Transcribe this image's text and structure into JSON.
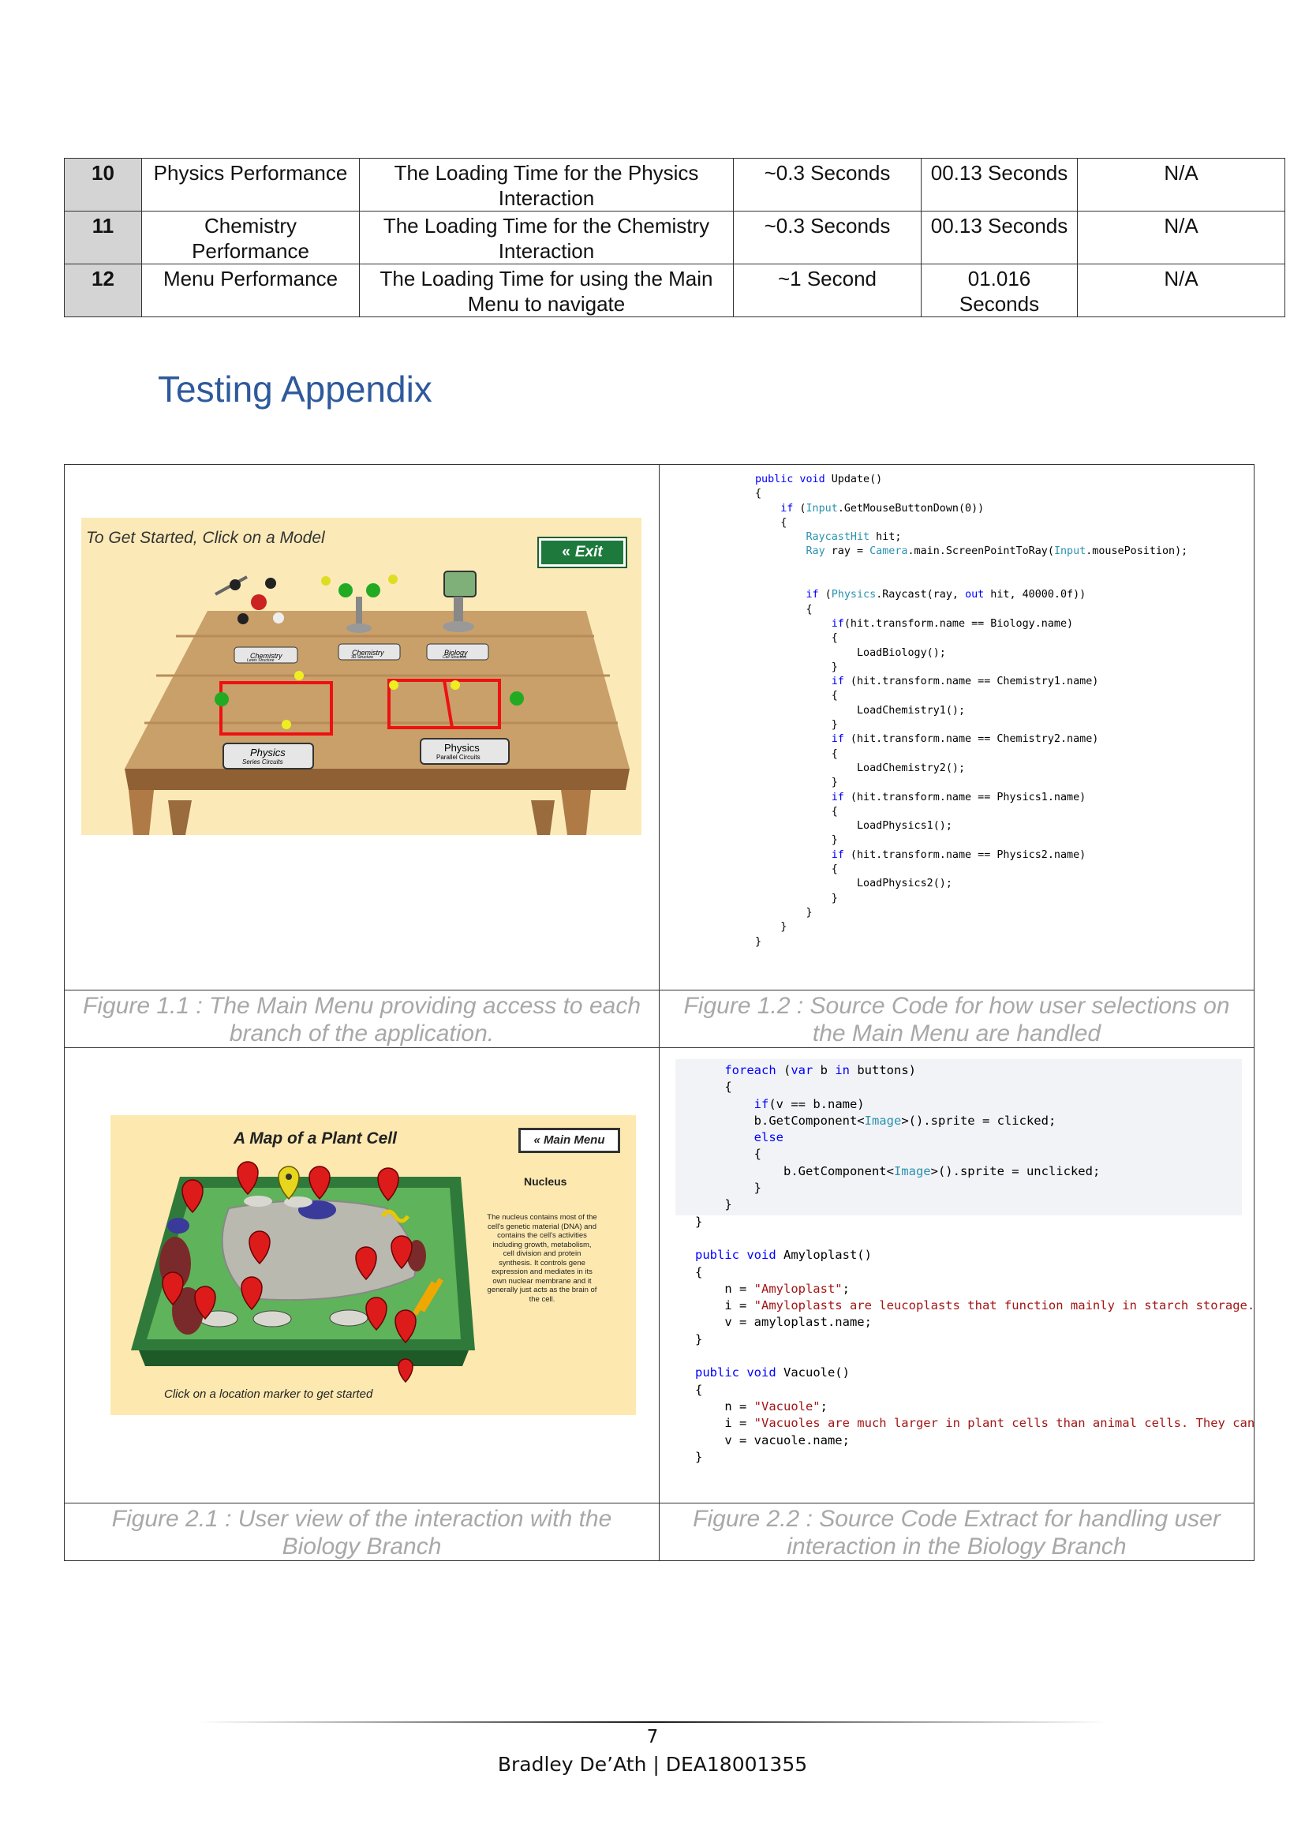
{
  "results_table": {
    "rows": [
      {
        "num": "10",
        "test": "Physics Performance",
        "description": "The Loading Time for the Physics Interaction",
        "expected": "~0.3 Seconds",
        "actual": "00.13 Seconds",
        "notes": "N/A"
      },
      {
        "num": "11",
        "test": "Chemistry Performance",
        "description": "The Loading Time for the Chemistry Interaction",
        "expected": "~0.3 Seconds",
        "actual": "00.13 Seconds",
        "notes": "N/A"
      },
      {
        "num": "12",
        "test": "Menu Performance",
        "description": "The Loading Time for using the Main Menu to navigate",
        "expected": "~1 Second",
        "actual": "01.016 Seconds",
        "notes": "N/A"
      }
    ]
  },
  "heading": "Testing Appendix",
  "figures": {
    "fig1_1": {
      "caption": "Figure 1.1 : The Main Menu providing access to each branch of the application.",
      "prompt": "To Get Started, Click on a Model",
      "exit_label": "Exit",
      "labels": [
        "Chemistry",
        "Chemistry",
        "Biology",
        "Physics",
        "Physics"
      ],
      "sublabels": [
        "Lewis Structure",
        "3D Structure",
        "Cell Structure",
        "Series Circuits",
        "Parallel Circuits"
      ]
    },
    "fig1_2": {
      "caption": "Figure 1.2 : Source Code for how user selections on the Main Menu are handled"
    },
    "fig2_1": {
      "caption": "Figure 2.1 : User view of the interaction with the Biology Branch",
      "title": "A Map of a Plant Cell",
      "menu_button": "Main Menu",
      "panel_title": "Nucleus",
      "panel_text": "The nucleus contains most of the cell's genetic material (DNA) and contains the cell's activities including growth, metabolism, cell division and protein synthesis. It controls gene expression and mediates in its own nuclear membrane and it generally just acts as the brain of the cell.",
      "hint": "Click on a location marker to get started"
    },
    "fig2_2": {
      "caption": "Figure 2.2 : Source Code Extract for handling user interaction in the Biology Branch"
    }
  },
  "footer": {
    "page_number": "7",
    "author": "Bradley De’Ath | DEA18001355"
  },
  "colors": {
    "heading": "#2e5a9c",
    "caption": "#a8a8a8",
    "keyword": "#0000ff",
    "type": "#2b91af",
    "string": "#a31515"
  }
}
